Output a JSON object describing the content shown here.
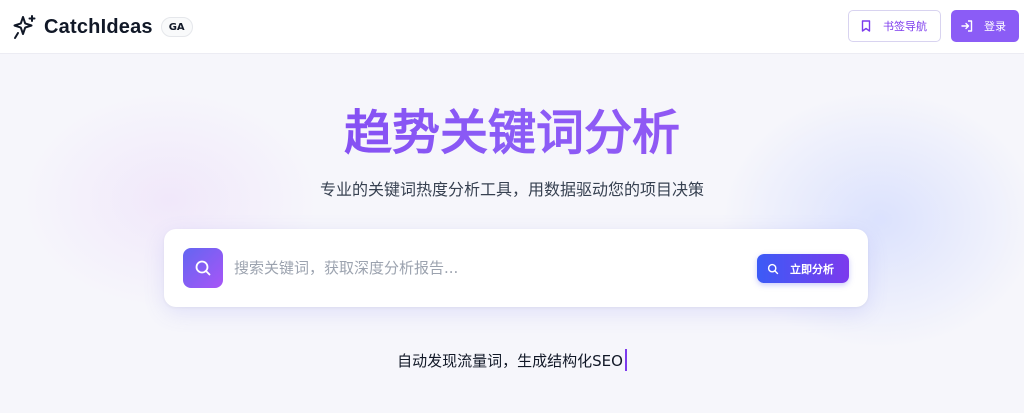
{
  "header": {
    "brand": "CatchIdeas",
    "badge": "GA",
    "bookmark_label": "书签导航",
    "login_label": "登录"
  },
  "hero": {
    "title": "趋势关键词分析",
    "subtitle": "专业的关键词热度分析工具，用数据驱动您的项目决策"
  },
  "search": {
    "placeholder": "搜索关键词，获取深度分析报告...",
    "value": "",
    "button_label": "立即分析"
  },
  "tagline": {
    "text": "自动发现流量词，生成结构化SEO"
  },
  "icons": {
    "logo": "sparkle-star-icon",
    "bookmark": "bookmark-icon",
    "login": "sign-in-icon",
    "search": "search-icon"
  },
  "colors": {
    "accent": "#8b5cf6",
    "title_gradient_start": "#7c3aed",
    "title_gradient_end": "#9b4ff0",
    "button_gradient_start": "#3b5bf6",
    "button_gradient_end": "#7c3aed"
  }
}
